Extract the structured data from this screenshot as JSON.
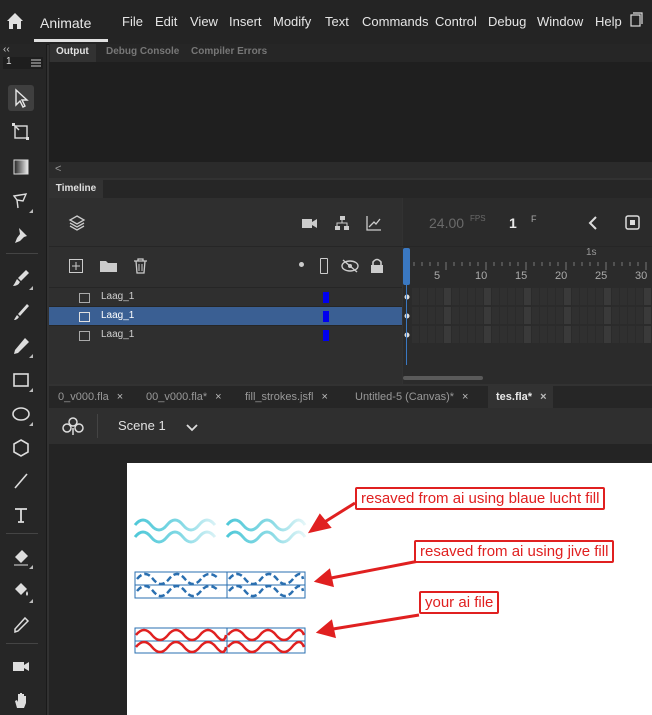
{
  "app": {
    "name": "Animate"
  },
  "menu": [
    "File",
    "Edit",
    "View",
    "Insert",
    "Modify",
    "Text",
    "Commands",
    "Control",
    "Debug",
    "Window",
    "Help"
  ],
  "tools": {
    "top_field": "1"
  },
  "output_panel": {
    "tabs": [
      "Output",
      "Debug Console",
      "Compiler Errors"
    ],
    "scroll_arrow": "<"
  },
  "timeline": {
    "tab": "Timeline",
    "fps_value": "24.00",
    "fps_unit": "FPS",
    "frame_value": "1",
    "frame_unit": "F",
    "ruler_marker": "1s",
    "ruler": [
      "5",
      "10",
      "15",
      "20",
      "25",
      "30"
    ],
    "layers": [
      {
        "name": "Laag_1",
        "selected": false
      },
      {
        "name": "Laag_1",
        "selected": true
      },
      {
        "name": "Laag_1",
        "selected": false
      }
    ],
    "layer_color": "#0000ee"
  },
  "doc_tabs": [
    {
      "label": "0_v000.fla",
      "close": "×"
    },
    {
      "label": "00_v000.fla*",
      "close": "×"
    },
    {
      "label": "fill_strokes.jsfl",
      "close": "×"
    },
    {
      "label": "Untitled-5 (Canvas)*",
      "close": "×"
    },
    {
      "label": "tes.fla*",
      "close": "×",
      "active": true
    }
  ],
  "scene": {
    "label": "Scene 1"
  },
  "annotations": [
    "resaved from ai using blaue lucht fill",
    "resaved from ai using jive fill",
    "your ai file"
  ],
  "colors": {
    "accent_red": "#e02020",
    "wave_cyan": "#4fc8d8",
    "wave_blue": "#2a6fb0",
    "wave_red": "#e02020",
    "playhead": "#3a78c2"
  }
}
